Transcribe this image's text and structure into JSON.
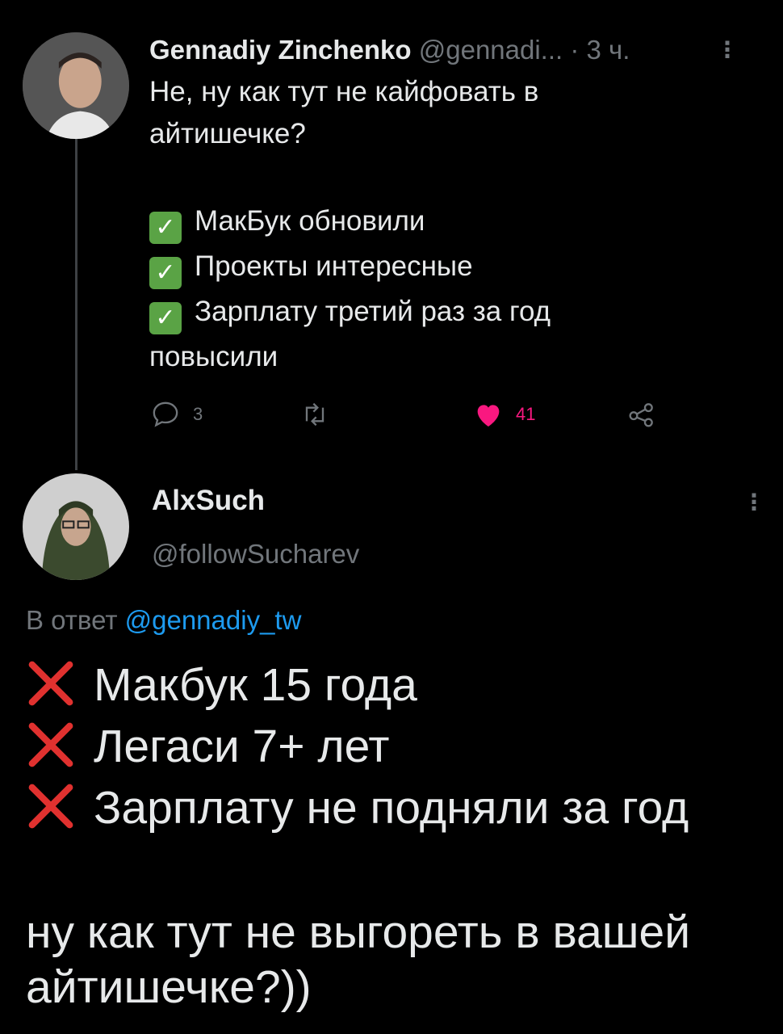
{
  "tweet1": {
    "author_name": "Gennadiy Zinchenko",
    "handle": "@gennadi...",
    "time": " · 3 ч.",
    "more_icon": "⋮",
    "line1": "Не, ну как тут не кайфовать в",
    "line2": "айтишечке?",
    "checklist": [
      "МакБук обновили",
      "Проекты интересные",
      "Зарплату третий раз за год"
    ],
    "continuation": "повысили",
    "replies": "3",
    "retweets": "",
    "likes": "41"
  },
  "tweet2": {
    "author_name": "AlxSuch",
    "handle": "@followSucharev",
    "more_icon": "⋮",
    "reply_prefix": "В ответ ",
    "reply_mention": "@gennadiy_tw",
    "crosslist": [
      "Макбук 15 года",
      "Легаси 7+ лет",
      "Зарплату не подняли за год"
    ],
    "tail_line1": "ну как тут не выгореть в вашей",
    "tail_line2": "айтишечке?))"
  },
  "colors": {
    "background": "#000000",
    "text": "#e7e9ea",
    "muted": "#71767b",
    "link": "#1d9bf0",
    "like": "#f91880",
    "check": "#5aa345",
    "cross": "#e0312f"
  },
  "icons": {
    "check": "check-mark-icon",
    "cross": "cross-mark-icon",
    "reply": "reply-icon",
    "retweet": "retweet-icon",
    "like": "heart-icon",
    "share": "share-icon"
  }
}
